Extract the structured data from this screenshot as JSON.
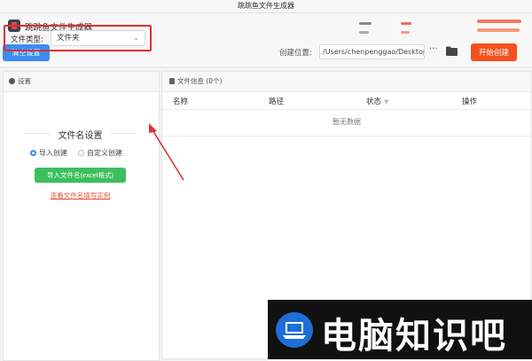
{
  "window": {
    "title": "跳跳鱼文件生成器"
  },
  "app": {
    "name": "跳跳鱼文件生成器"
  },
  "toolbar": {
    "clear_label": "清空设置",
    "path_label": "创建位置:",
    "path_value": "/Users/chenpenggao/Desktop",
    "more_label": "···",
    "start_label": "开始创建"
  },
  "settings": {
    "header": "设置",
    "file_type_label": "文件类型:",
    "file_type_value": "文件夹",
    "filename_title": "文件名设置",
    "radio_import": "导入创建",
    "radio_custom": "自定义创建",
    "import_button": "导入文件名(excel格式)",
    "example_link": "查看文件名填写实例"
  },
  "file_info": {
    "header": "文件信息 (0个)",
    "columns": [
      "名称",
      "路径",
      "状态",
      "操作"
    ],
    "empty_text": "暂无数据"
  },
  "watermark": {
    "text": "电脑知识吧"
  },
  "colors": {
    "primary": "#3c8cf0",
    "start": "#f4511e",
    "import": "#3cbf5c",
    "highlight": "#e03030"
  }
}
